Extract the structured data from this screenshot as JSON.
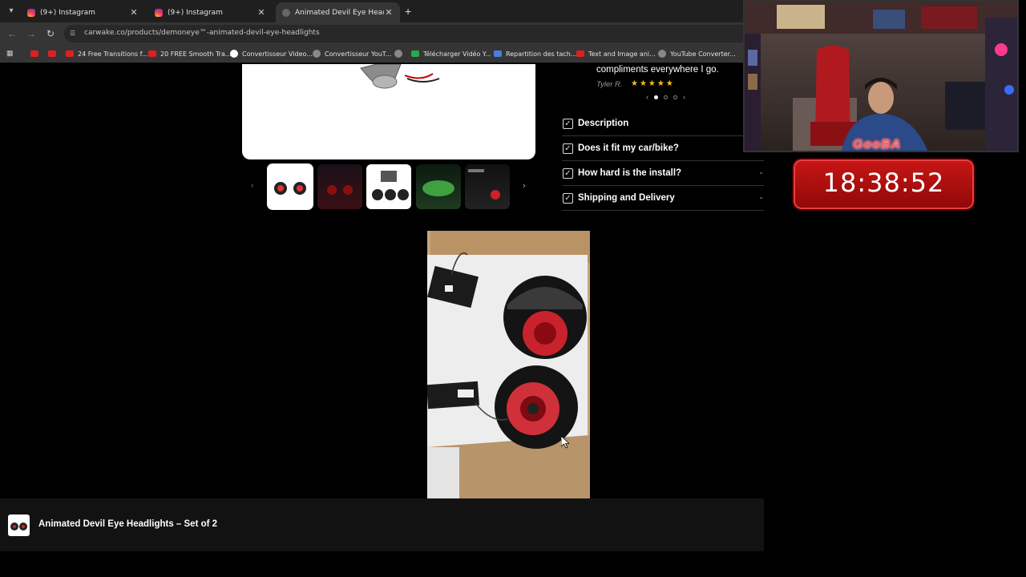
{
  "browser": {
    "tabs": [
      {
        "title": "(9+) Instagram",
        "icon": "instagram-icon"
      },
      {
        "title": "(9+) Instagram",
        "icon": "instagram-icon"
      },
      {
        "title": "Animated Devil Eye Headlights",
        "icon": "globe-icon",
        "active": true
      }
    ],
    "url": "carwake.co/products/demoneye™-animated-devil-eye-headlights",
    "bookmarks": [
      {
        "label": "",
        "icon": "youtube-icon"
      },
      {
        "label": "",
        "icon": "youtube-icon"
      },
      {
        "label": "24 Free Transitions f...",
        "icon": "youtube-icon"
      },
      {
        "label": "20 FREE Smooth Tra...",
        "icon": "youtube-icon"
      },
      {
        "label": "Convertisseur Video...",
        "icon": "google-icon"
      },
      {
        "label": "Convertisseur YouT...",
        "icon": "converter-icon"
      },
      {
        "label": "",
        "icon": "globe-icon"
      },
      {
        "label": "Télécharger Vidéo Y...",
        "icon": "download-icon"
      },
      {
        "label": "Repartition des tach...",
        "icon": "docs-icon"
      },
      {
        "label": "Text and Image ani...",
        "icon": "youtube-icon"
      },
      {
        "label": "YouTube Converter...",
        "icon": "globe-icon"
      }
    ]
  },
  "review": {
    "text": "compliments everywhere I go.",
    "author": "Tyler R.",
    "stars": "★★★★★"
  },
  "accordion": [
    {
      "label": "Description"
    },
    {
      "label": "Does it fit my car/bike?"
    },
    {
      "label": "How hard is the install?"
    },
    {
      "label": "Shipping and Delivery"
    }
  ],
  "sticky": {
    "title": "Animated Devil Eye Headlights – Set of 2"
  },
  "overlay": {
    "name": "GooBA",
    "clock": "18:38:52"
  },
  "colors": {
    "accent": "#c81616",
    "star": "#f3c218"
  }
}
